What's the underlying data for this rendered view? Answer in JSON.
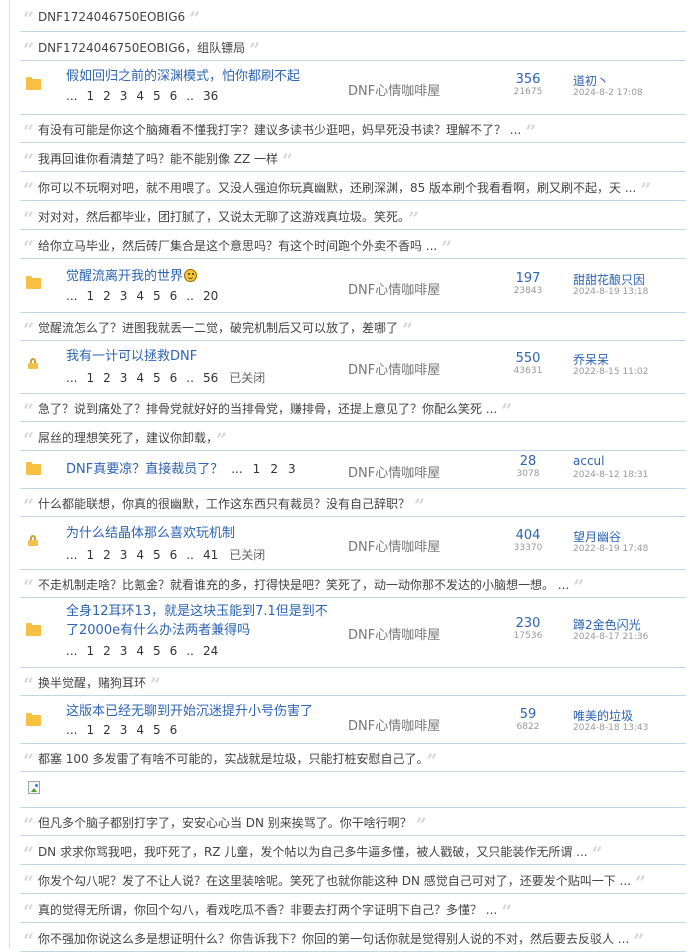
{
  "quotes": [
    "DNF1724046750EOBIG6",
    "DNF1724046750EOBIG6，组队镖局",
    "有没有可能是你这个脑瘫看不懂我打字？建议多读书少逛吧，妈早死没书读？理解不了？ ...",
    "我再回谁你看清楚了吗？能不能别像 ZZ 一样",
    "你可以不玩啊对吧，就不用喂了。又没人强迫你玩真幽默，还刷深渊，85 版本刷个我看看啊，刷又刷不起，天 ...",
    "对对对，然后都毕业，团打腻了，又说太无聊了这游戏真垃圾。笑死。",
    "给你立马毕业，然后砖厂集合是这个意思吗？有这个时间跑个外卖不香吗 ...",
    "觉醒流怎么了？进图我就丢一二觉，破完机制后又可以放了，差哪了",
    "急了？说到痛处了？排骨党就好好的当排骨党，赚排骨，还提上意见了？你配么笑死 ...",
    "屌丝的理想笑死了，建议你卸载，",
    "什么都能联想，你真的很幽默，工作这东西只有裁员？没有自己辞职？",
    "不走机制走啥？比氪金？就看谁充的多，打得快是吧？笑死了，动一动你那不发达的小脑想一想。 ...",
    "换半觉醒，赌狗耳环",
    "都塞 100 多发雷了有啥不可能的，实战就是垃圾，只能打桩安慰自己了。",
    "但凡多个脑子都别打字了，安安心心当 DN 别来挨骂了。你干啥行啊？",
    "DN 求求你骂我吧，我吓死了，RZ 儿童，发个帖以为自己多牛逼多懂，被人戳破，又只能装作无所谓 ...",
    "你发个勾八呢？发了不让人说？在这里装啥呢。笑死了也就你能这种 DN 感觉自己可对了，还要发个贴叫一下 ...",
    "真的觉得无所谓，你回个勾八，看戏吃瓜不香？非要去打两个字证明下自己？多懂？ ...",
    "你不强加你说这么多是想证明什么？你告诉我下？你回的第一句话你就是觉得别人说的不对，然后要去反驳人 ..."
  ],
  "threads": [
    {
      "title": "假如回归之前的深渊模式，怕你都刷不起",
      "pages": [
        "...",
        "1",
        "2",
        "3",
        "4",
        "5",
        "6",
        "..",
        "36"
      ],
      "forum": "DNF心情咖啡屋",
      "replies": "356",
      "views": "21675",
      "author": "道初丶",
      "date": "2024-8-2 17:08"
    },
    {
      "title": "觉醒流离开我的世界",
      "pages": [
        "...",
        "1",
        "2",
        "3",
        "4",
        "5",
        "6",
        "..",
        "20"
      ],
      "forum": "DNF心情咖啡屋",
      "replies": "197",
      "views": "23843",
      "author": "甜甜花酿只因",
      "date": "2024-8-19 13:18"
    },
    {
      "title": "我有一计可以拯救DNF",
      "pages": [
        "...",
        "1",
        "2",
        "3",
        "4",
        "5",
        "6",
        "..",
        "56"
      ],
      "closed": "已关闭",
      "forum": "DNF心情咖啡屋",
      "replies": "550",
      "views": "43631",
      "author": "乔呆呆",
      "date": "2022-8-15 11:02"
    },
    {
      "title": "DNF真要凉？直接裁员了？",
      "pages": [
        "...",
        "1",
        "2",
        "3"
      ],
      "forum": "DNF心情咖啡屋",
      "replies": "28",
      "views": "3078",
      "author": "accul",
      "date": "2024-8-12 18:31"
    },
    {
      "title": "为什么结晶体那么喜欢玩机制",
      "pages": [
        "...",
        "1",
        "2",
        "3",
        "4",
        "5",
        "6",
        "..",
        "41"
      ],
      "closed": "已关闭",
      "forum": "DNF心情咖啡屋",
      "replies": "404",
      "views": "33370",
      "author": "望月幽谷",
      "date": "2022-8-19 17:48"
    },
    {
      "title": "全身12耳环13，就是这块玉能到7.1但是到不了2000e有什么办法两者兼得吗",
      "pages": [
        "...",
        "1",
        "2",
        "3",
        "4",
        "5",
        "6",
        "..",
        "24"
      ],
      "forum": "DNF心情咖啡屋",
      "replies": "230",
      "views": "17536",
      "author": "蹲2金色闪光",
      "date": "2024-8-17 21:36"
    },
    {
      "title": "这版本已经无聊到开始沉迷提升小号伤害了",
      "pages": [
        "...",
        "1",
        "2",
        "3",
        "4",
        "5",
        "6"
      ],
      "forum": "DNF心情咖啡屋",
      "replies": "59",
      "views": "6822",
      "author": "唯美的垃圾",
      "date": "2024-8-18 13:43"
    }
  ],
  "icons": {
    "folder": "folder-icon",
    "lock": "lock-icon",
    "quote": "quote-icon",
    "smiley": "smiley-icon",
    "broken_image": "broken-image-icon"
  },
  "colors": {
    "link": "#2d64b3",
    "divider": "#c2d5e3",
    "folder": "#f7c042",
    "quote_mark": "#d7d7d7"
  }
}
